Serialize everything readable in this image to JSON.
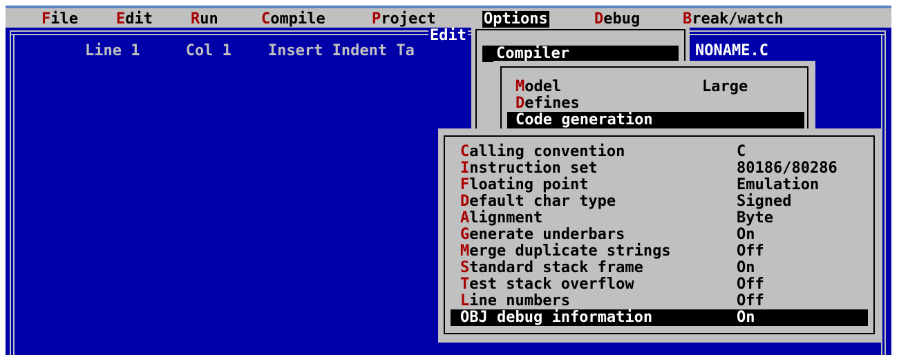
{
  "menubar": {
    "items": [
      {
        "hot": "F",
        "rest": "ile"
      },
      {
        "hot": "E",
        "rest": "dit"
      },
      {
        "hot": "R",
        "rest": "un"
      },
      {
        "hot": "C",
        "rest": "ompile"
      },
      {
        "hot": "P",
        "rest": "roject"
      },
      {
        "hot": "",
        "rest": "Options"
      },
      {
        "hot": "D",
        "rest": "ebug"
      },
      {
        "hot": "B",
        "rest": "reak/watch"
      }
    ]
  },
  "editor": {
    "title": "Edit",
    "status": "Line 1     Col 1    Insert Indent Ta",
    "file_name": "NONAME.C"
  },
  "options_menu": {
    "selected_item": "Compiler"
  },
  "compiler_menu": {
    "items": [
      {
        "hot": "M",
        "rest": "odel",
        "value": "Large"
      },
      {
        "hot": "D",
        "rest": "efines",
        "value": ""
      },
      {
        "hot": "",
        "rest": "Code generation",
        "value": ""
      }
    ]
  },
  "code_generation": {
    "items": [
      {
        "hot": "C",
        "rest": "alling convention",
        "value": "C"
      },
      {
        "hot": "I",
        "rest": "nstruction set",
        "value": "80186/80286"
      },
      {
        "hot": "F",
        "rest": "loating point",
        "value": "Emulation"
      },
      {
        "hot": "D",
        "rest": "efault char type",
        "value": "Signed"
      },
      {
        "hot": "A",
        "rest": "lignment",
        "value": "Byte"
      },
      {
        "hot": "G",
        "rest": "enerate underbars",
        "value": "On"
      },
      {
        "hot": "M",
        "rest": "erge duplicate strings",
        "value": "Off"
      },
      {
        "hot": "S",
        "rest": "tandard stack frame",
        "value": "On"
      },
      {
        "hot": "T",
        "rest": "est stack overflow",
        "value": "Off"
      },
      {
        "hot": "L",
        "rest": "ine numbers",
        "value": "Off"
      },
      {
        "hot": "",
        "rest": "OBJ debug information",
        "value": "On"
      }
    ]
  },
  "colors": {
    "editor_background": "#0000a8",
    "menu_background": "#c0c0c0",
    "hotkey": "#a80000",
    "selection": "#000000"
  }
}
